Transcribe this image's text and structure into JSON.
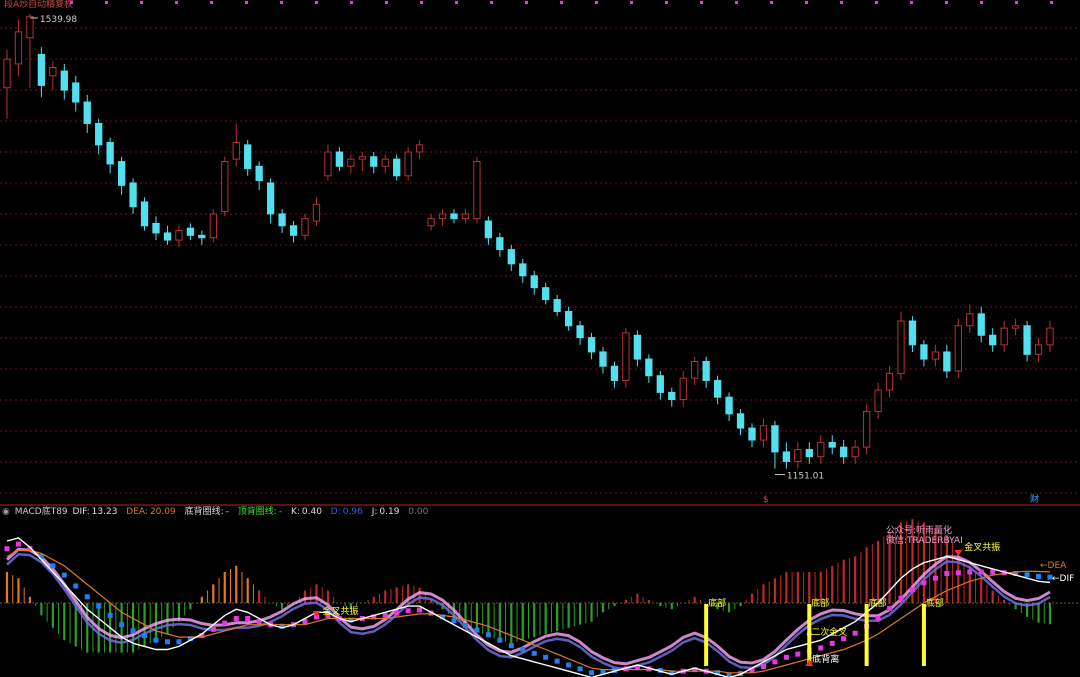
{
  "header": {
    "title": "MACD底T89",
    "dif_label": "DIF:",
    "dif_value": "13.23",
    "dea_label": "DEA:",
    "dea_value": "20.09",
    "dbxian_label": "底背圈线:",
    "dbxian_value": "-",
    "dingbei_label": "顶背圈线:",
    "dingbei_value": "-",
    "k_label": "K:",
    "k_value": "0.40",
    "d_label": "D:",
    "d_value": "0.96",
    "j_label": "J:",
    "j_value": "0.19",
    "extra_value": "0.00"
  },
  "top_title": "段A炒自动精复权",
  "colors": {
    "up": "#b83232",
    "down": "#52e0f0",
    "grid": "#8a1a1a",
    "dif": "#ffffff",
    "dea": "#e07828",
    "yellow": "#ffff30",
    "pink": "#f0a0f0",
    "blue": "#2080f0",
    "magenta": "#e838e0",
    "green": "#40c040"
  },
  "chart_data": {
    "type": "candlestick",
    "price": {
      "title": "",
      "high_label": "1539.98",
      "low_label": "1151.01",
      "ylim": [
        1140,
        1545
      ],
      "candles": [
        [
          1478,
          1502,
          1452,
          1510
        ],
        [
          1498,
          1525,
          1488,
          1535
        ],
        [
          1520,
          1538,
          1478,
          1540
        ],
        [
          1506,
          1480,
          1470,
          1512
        ],
        [
          1488,
          1495,
          1476,
          1500
        ],
        [
          1492,
          1476,
          1468,
          1498
        ],
        [
          1482,
          1466,
          1458,
          1488
        ],
        [
          1466,
          1448,
          1440,
          1472
        ],
        [
          1448,
          1430,
          1422,
          1452
        ],
        [
          1432,
          1414,
          1406,
          1436
        ],
        [
          1416,
          1396,
          1388,
          1420
        ],
        [
          1398,
          1378,
          1372,
          1402
        ],
        [
          1382,
          1362,
          1358,
          1386
        ],
        [
          1364,
          1356,
          1350,
          1370
        ],
        [
          1356,
          1350,
          1346,
          1362
        ],
        [
          1350,
          1358,
          1344,
          1362
        ],
        [
          1360,
          1354,
          1350,
          1364
        ],
        [
          1354,
          1352,
          1346,
          1358
        ],
        [
          1352,
          1372,
          1348,
          1376
        ],
        [
          1374,
          1416,
          1370,
          1420
        ],
        [
          1418,
          1432,
          1412,
          1448
        ],
        [
          1430,
          1410,
          1404,
          1434
        ],
        [
          1412,
          1400,
          1392,
          1416
        ],
        [
          1398,
          1372,
          1364,
          1402
        ],
        [
          1372,
          1362,
          1356,
          1376
        ],
        [
          1362,
          1354,
          1348,
          1366
        ],
        [
          1354,
          1368,
          1350,
          1372
        ],
        [
          1366,
          1380,
          1362,
          1386
        ],
        [
          1404,
          1424,
          1400,
          1430
        ],
        [
          1424,
          1412,
          1408,
          1428
        ],
        [
          1412,
          1418,
          1406,
          1422
        ],
        [
          1418,
          1420,
          1408,
          1424
        ],
        [
          1420,
          1412,
          1406,
          1424
        ],
        [
          1412,
          1418,
          1406,
          1422
        ],
        [
          1418,
          1404,
          1400,
          1422
        ],
        [
          1404,
          1424,
          1400,
          1428
        ],
        [
          1424,
          1430,
          1418,
          1434
        ],
        [
          1362,
          1368,
          1358,
          1372
        ],
        [
          1368,
          1372,
          1362,
          1376
        ],
        [
          1372,
          1368,
          1364,
          1376
        ],
        [
          1368,
          1372,
          1364,
          1376
        ],
        [
          1368,
          1416,
          1364,
          1420
        ],
        [
          1366,
          1352,
          1346,
          1370
        ],
        [
          1352,
          1342,
          1336,
          1356
        ],
        [
          1342,
          1330,
          1324,
          1346
        ],
        [
          1330,
          1320,
          1314,
          1334
        ],
        [
          1320,
          1310,
          1304,
          1324
        ],
        [
          1310,
          1300,
          1296,
          1314
        ],
        [
          1300,
          1290,
          1286,
          1304
        ],
        [
          1290,
          1278,
          1274,
          1294
        ],
        [
          1278,
          1268,
          1262,
          1282
        ],
        [
          1268,
          1256,
          1250,
          1272
        ],
        [
          1256,
          1244,
          1238,
          1260
        ],
        [
          1244,
          1232,
          1226,
          1248
        ],
        [
          1232,
          1272,
          1226,
          1276
        ],
        [
          1270,
          1250,
          1244,
          1274
        ],
        [
          1250,
          1236,
          1230,
          1254
        ],
        [
          1236,
          1222,
          1216,
          1240
        ],
        [
          1222,
          1216,
          1210,
          1226
        ],
        [
          1216,
          1234,
          1210,
          1240
        ],
        [
          1234,
          1248,
          1228,
          1252
        ],
        [
          1248,
          1232,
          1226,
          1252
        ],
        [
          1232,
          1218,
          1212,
          1236
        ],
        [
          1218,
          1204,
          1198,
          1222
        ],
        [
          1204,
          1192,
          1186,
          1208
        ],
        [
          1192,
          1182,
          1176,
          1196
        ],
        [
          1182,
          1194,
          1176,
          1200
        ],
        [
          1194,
          1172,
          1158,
          1198
        ],
        [
          1172,
          1164,
          1158,
          1180
        ],
        [
          1164,
          1174,
          1158,
          1180
        ],
        [
          1174,
          1168,
          1162,
          1180
        ],
        [
          1168,
          1180,
          1162,
          1186
        ],
        [
          1180,
          1176,
          1170,
          1186
        ],
        [
          1176,
          1168,
          1162,
          1182
        ],
        [
          1168,
          1176,
          1162,
          1182
        ],
        [
          1176,
          1206,
          1170,
          1212
        ],
        [
          1206,
          1224,
          1200,
          1230
        ],
        [
          1224,
          1238,
          1218,
          1244
        ],
        [
          1238,
          1282,
          1232,
          1290
        ],
        [
          1282,
          1262,
          1256,
          1286
        ],
        [
          1262,
          1250,
          1244,
          1266
        ],
        [
          1250,
          1256,
          1244,
          1262
        ],
        [
          1256,
          1240,
          1234,
          1262
        ],
        [
          1240,
          1278,
          1234,
          1284
        ],
        [
          1278,
          1288,
          1272,
          1296
        ],
        [
          1288,
          1270,
          1264,
          1294
        ],
        [
          1270,
          1262,
          1256,
          1276
        ],
        [
          1262,
          1276,
          1256,
          1282
        ],
        [
          1276,
          1278,
          1270,
          1284
        ],
        [
          1278,
          1254,
          1248,
          1282
        ],
        [
          1254,
          1262,
          1248,
          1268
        ],
        [
          1262,
          1276,
          1256,
          1282
        ]
      ]
    },
    "macd": {
      "title": "MACD底T89",
      "series": [
        {
          "name": "DIF",
          "values": [
            40,
            42,
            36,
            28,
            20,
            12,
            4,
            -4,
            -10,
            -16,
            -22,
            -26,
            -28,
            -30,
            -30,
            -28,
            -24,
            -20,
            -14,
            -8,
            -4,
            -6,
            -10,
            -14,
            -16,
            -14,
            -10,
            -6,
            -6,
            -10,
            -12,
            -10,
            -8,
            -6,
            -4,
            -2,
            -2,
            -6,
            -10,
            -14,
            -18,
            -22,
            -26,
            -30,
            -34,
            -36,
            -38,
            -40,
            -42,
            -44,
            -46,
            -48,
            -46,
            -44,
            -42,
            -40,
            -42,
            -44,
            -46,
            -44,
            -42,
            -44,
            -46,
            -48,
            -46,
            -42,
            -38,
            -34,
            -30,
            -28,
            -26,
            -24,
            -20,
            -16,
            -12,
            -6,
            0,
            8,
            16,
            22,
            26,
            28,
            30,
            28,
            26,
            24,
            22,
            20,
            18,
            16,
            14,
            13.23
          ]
        },
        {
          "name": "DEA",
          "values": [
            30,
            34,
            34,
            32,
            28,
            24,
            18,
            12,
            6,
            0,
            -6,
            -10,
            -14,
            -18,
            -20,
            -22,
            -22,
            -22,
            -20,
            -18,
            -16,
            -14,
            -14,
            -14,
            -14,
            -14,
            -14,
            -12,
            -10,
            -10,
            -10,
            -10,
            -10,
            -10,
            -9,
            -8,
            -7,
            -7,
            -8,
            -9,
            -11,
            -13,
            -15,
            -18,
            -21,
            -24,
            -27,
            -30,
            -33,
            -36,
            -39,
            -42,
            -43,
            -43,
            -43,
            -43,
            -43,
            -43,
            -44,
            -44,
            -44,
            -44,
            -44,
            -45,
            -45,
            -45,
            -44,
            -42,
            -40,
            -38,
            -36,
            -34,
            -32,
            -30,
            -27,
            -24,
            -20,
            -15,
            -10,
            -5,
            0,
            4,
            8,
            11,
            14,
            16,
            18,
            19,
            20,
            20.5,
            20.3,
            20.09
          ]
        }
      ],
      "labels": [
        "底背离",
        "二次金叉",
        "金叉共振",
        "底部",
        "公众号:听雨量化",
        "微信:TRADERBYAI",
        "DEA",
        "DIF"
      ],
      "marks": [
        "$",
        "财"
      ]
    }
  }
}
